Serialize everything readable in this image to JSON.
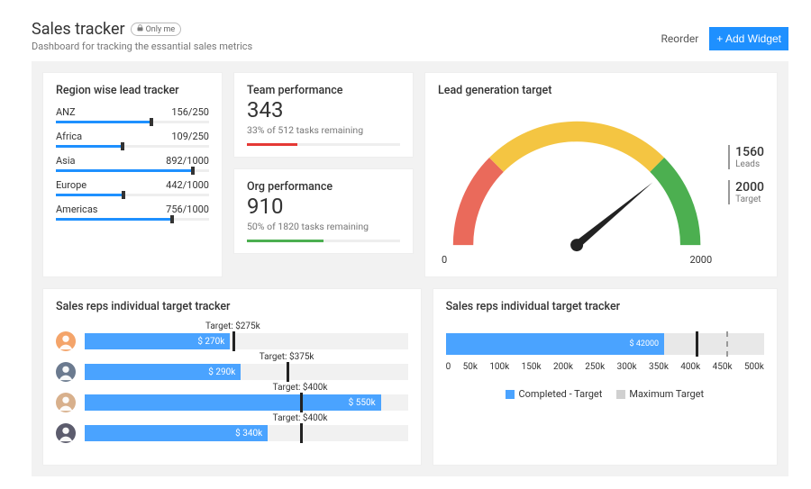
{
  "header": {
    "title": "Sales tracker",
    "badge": "Only me",
    "subtitle": "Dashboard for tracking the essantial sales metrics",
    "reorder": "Reorder",
    "add_widget": "+ Add Widget"
  },
  "region": {
    "title": "Region wise lead tracker",
    "items": [
      {
        "name": "ANZ",
        "value": 156,
        "max": 250,
        "label": "156/250"
      },
      {
        "name": "Africa",
        "value": 109,
        "max": 250,
        "label": "109/250"
      },
      {
        "name": "Asia",
        "value": 892,
        "max": 1000,
        "label": "892/1000"
      },
      {
        "name": "Europe",
        "value": 442,
        "max": 1000,
        "label": "442/1000"
      },
      {
        "name": "Americas",
        "value": 756,
        "max": 1000,
        "label": "756/1000"
      }
    ]
  },
  "team": {
    "title": "Team performance",
    "value": "343",
    "sub": "33% of 512 tasks remaining",
    "pct": 33,
    "color": "#e53935"
  },
  "org": {
    "title": "Org performance",
    "value": "910",
    "sub": "50% of 1820 tasks remaining",
    "pct": 50,
    "color": "#4caf50"
  },
  "gauge": {
    "title": "Lead generation target",
    "min": 0,
    "max": 2000,
    "value": 1560,
    "min_label": "0",
    "max_label": "2000",
    "leads": {
      "val": "1560",
      "lbl": "Leads"
    },
    "target": {
      "val": "2000",
      "lbl": "Target"
    }
  },
  "reps": {
    "title": "Sales reps individual target tracker",
    "max": 600,
    "items": [
      {
        "value": 270,
        "target": 275,
        "value_label": "$ 270k",
        "target_label": "Target: $275k"
      },
      {
        "value": 290,
        "target": 375,
        "value_label": "$ 290k",
        "target_label": "Target: $375k"
      },
      {
        "value": 550,
        "target": 400,
        "value_label": "$ 550k",
        "target_label": "Target: $400k"
      },
      {
        "value": 340,
        "target": 400,
        "value_label": "$ 340k",
        "target_label": "Target: $400k"
      }
    ]
  },
  "summary": {
    "title": "Sales reps individual target tracker",
    "value": 350000,
    "value_label": "$ 42000",
    "target": 400000,
    "max_mark": 450000,
    "scale_max": 510000,
    "ticks": [
      "0",
      "50k",
      "100k",
      "150k",
      "200k",
      "250k",
      "300k",
      "350k",
      "400k",
      "450k",
      "500k"
    ],
    "legend": {
      "completed": "Completed - Target",
      "max": "Maximum Target"
    }
  },
  "chart_data": [
    {
      "type": "bar",
      "title": "Region wise lead tracker",
      "categories": [
        "ANZ",
        "Africa",
        "Asia",
        "Europe",
        "Americas"
      ],
      "values": [
        156,
        109,
        892,
        442,
        756
      ],
      "max_values": [
        250,
        250,
        1000,
        1000,
        1000
      ]
    },
    {
      "type": "gauge",
      "title": "Lead generation target",
      "min": 0,
      "max": 2000,
      "value": 1560
    },
    {
      "type": "bar",
      "title": "Sales reps individual target tracker",
      "orientation": "horizontal",
      "currency_unit": "k$",
      "series": [
        {
          "name": "Completed",
          "values": [
            270,
            290,
            550,
            340
          ]
        },
        {
          "name": "Target",
          "values": [
            275,
            375,
            400,
            400
          ]
        }
      ],
      "xlim": [
        0,
        600
      ]
    },
    {
      "type": "bar",
      "title": "Sales reps individual target tracker (summary)",
      "orientation": "horizontal",
      "series": [
        {
          "name": "Completed - Target",
          "values": [
            350000
          ]
        },
        {
          "name": "Target",
          "values": [
            400000
          ]
        },
        {
          "name": "Maximum Target",
          "values": [
            450000
          ]
        }
      ],
      "xlim": [
        0,
        500000
      ]
    }
  ]
}
